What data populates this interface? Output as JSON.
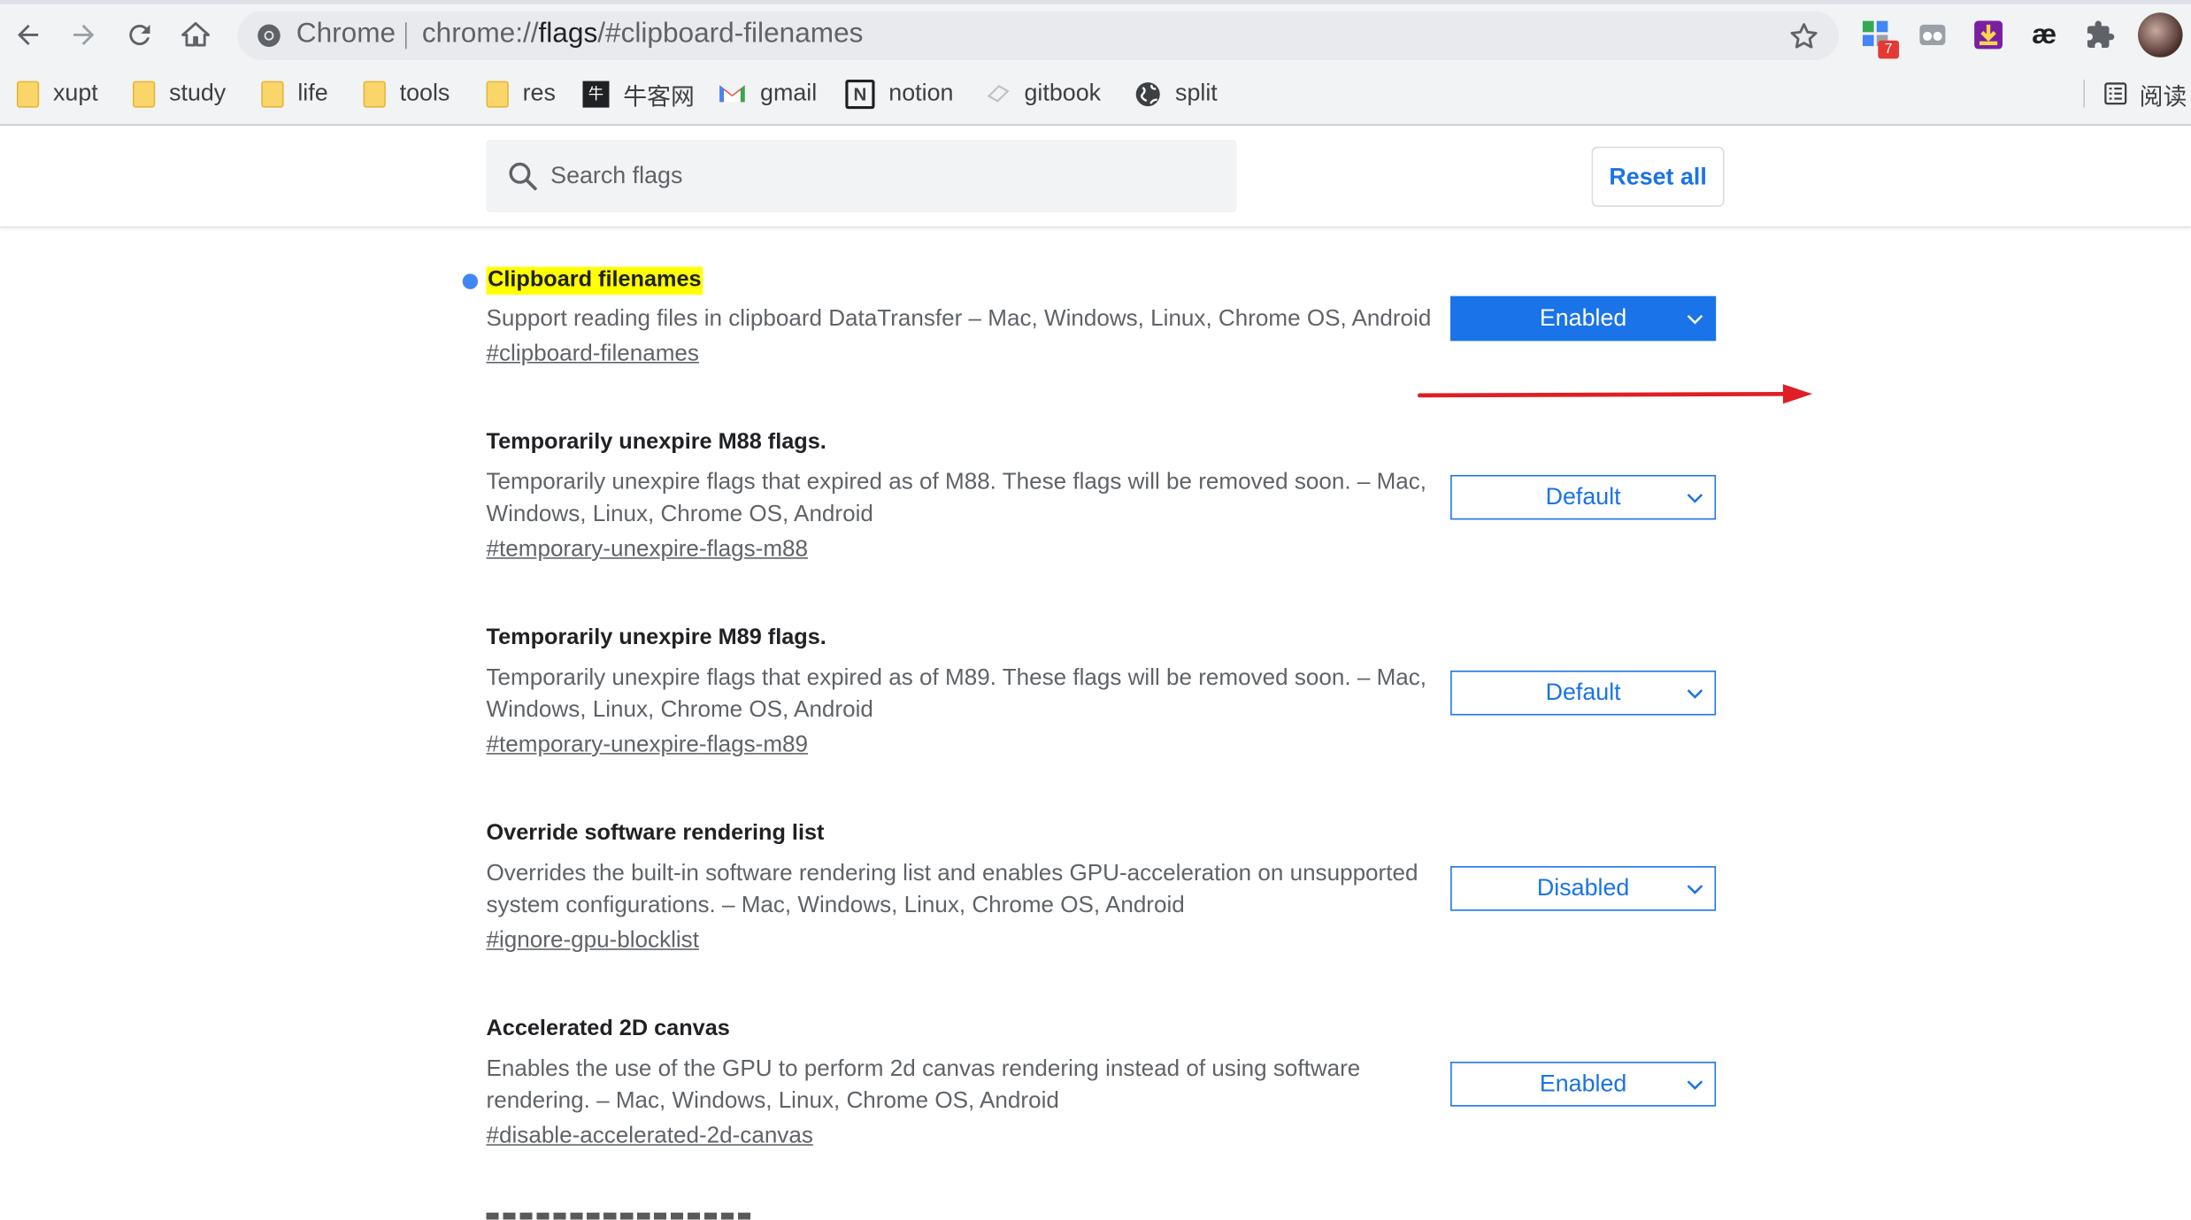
{
  "toolbar": {
    "omnibox_label": "Chrome",
    "url_prefix": "chrome://",
    "url_host": "flags",
    "url_path": "/#clipboard-filenames",
    "extension_badge": "7"
  },
  "bookmarks": [
    {
      "label": "xupt",
      "icon": "folder-icon"
    },
    {
      "label": "study",
      "icon": "folder-icon"
    },
    {
      "label": "life",
      "icon": "folder-icon"
    },
    {
      "label": "tools",
      "icon": "folder-icon"
    },
    {
      "label": "res",
      "icon": "folder-icon"
    },
    {
      "label": "牛客网",
      "icon": "nowcoder-icon"
    },
    {
      "label": "gmail",
      "icon": "gmail-icon"
    },
    {
      "label": "notion",
      "icon": "notion-icon"
    },
    {
      "label": "gitbook",
      "icon": "gitbook-icon"
    },
    {
      "label": "split",
      "icon": "globe-icon"
    }
  ],
  "reading_list_label": "阅读",
  "header": {
    "search_placeholder": "Search flags",
    "reset_label": "Reset all"
  },
  "experiments": [
    {
      "title": "Clipboard filenames",
      "description": "Support reading files in clipboard DataTransfer – Mac, Windows, Linux, Chrome OS, Android",
      "link": "#clipboard-filenames",
      "state": "Enabled",
      "modified": true
    },
    {
      "title": "Temporarily unexpire M88 flags.",
      "description": "Temporarily unexpire flags that expired as of M88. These flags will be removed soon. – Mac, Windows, Linux, Chrome OS, Android",
      "link": "#temporary-unexpire-flags-m88",
      "state": "Default",
      "modified": false
    },
    {
      "title": "Temporarily unexpire M89 flags.",
      "description": "Temporarily unexpire flags that expired as of M89. These flags will be removed soon. – Mac, Windows, Linux, Chrome OS, Android",
      "link": "#temporary-unexpire-flags-m89",
      "state": "Default",
      "modified": false
    },
    {
      "title": "Override software rendering list",
      "description": "Overrides the built-in software rendering list and enables GPU-acceleration on unsupported system configurations. – Mac, Windows, Linux, Chrome OS, Android",
      "link": "#ignore-gpu-blocklist",
      "state": "Disabled",
      "modified": false
    },
    {
      "title": "Accelerated 2D canvas",
      "description": "Enables the use of the GPU to perform 2d canvas rendering instead of using software rendering. – Mac, Windows, Linux, Chrome OS, Android",
      "link": "#disable-accelerated-2d-canvas",
      "state": "Enabled",
      "modified": false
    }
  ],
  "colors": {
    "accent": "#1a73e8",
    "highlight": "#ffff00",
    "annotation_arrow": "#e01e26",
    "modified_dot": "#4285f4"
  }
}
